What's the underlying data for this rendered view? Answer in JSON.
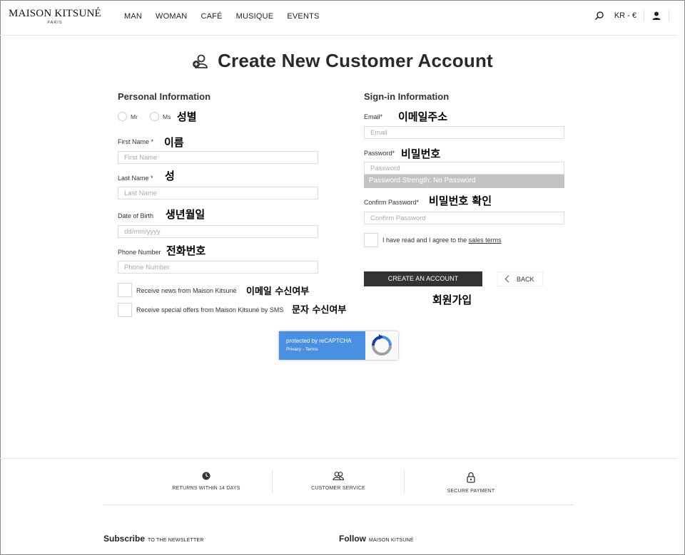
{
  "header": {
    "logo": "MAISON KITSUNÉ",
    "logo_sub": "PARIS",
    "nav": [
      "MAN",
      "WOMAN",
      "CAFÉ",
      "MUSIQUE",
      "EVENTS"
    ],
    "lang": "KR - €"
  },
  "page": {
    "title": "Create New Customer Account"
  },
  "personal": {
    "heading": "Personal Information",
    "mr": "Mr",
    "ms": "Ms",
    "gender_ko": "성별",
    "first_name_label": "First Name *",
    "first_name_ko": "이름",
    "first_name_ph": "First Name",
    "last_name_label": "Last Name *",
    "last_name_ko": "성",
    "last_name_ph": "Last Name",
    "dob_label": "Date of Birth",
    "dob_ko": "생년월일",
    "dob_ph": "dd/mm/yyyy",
    "phone_label": "Phone Number",
    "phone_ko": "전화번호",
    "phone_ph": "Phone Number",
    "news_label": "Receive news from Maison Kitsuné",
    "news_ko": "이메일 수신여부",
    "sms_label": "Receive special offers from Maison Kitsuné by SMS",
    "sms_ko": "문자 수신여부"
  },
  "signin": {
    "heading": "Sign-in Information",
    "email_label": "Email*",
    "email_ko": "이메일주소",
    "email_ph": "Email",
    "password_label": "Password*",
    "password_ko": "비밀번호",
    "password_ph": "Password",
    "strength": "Password Strength: No Password",
    "confirm_label": "Confirm Password*",
    "confirm_ko": "비밀번호 확인",
    "confirm_ph": "Confirm Password",
    "terms_prefix": "I have read and I agree to the ",
    "terms_link": "sales terms",
    "create_button": "CREATE AN ACCOUNT",
    "back_button": "BACK",
    "join_ko": "회원가입"
  },
  "recaptcha": {
    "line1": "protected by reCAPTCHA",
    "line2": "Privacy - Terms"
  },
  "footer": {
    "services": [
      "RETURNS WITHIN 14 DAYS",
      "CUSTOMER SERVICE",
      "SECURE PAYMENT"
    ],
    "subscribe": "Subscribe",
    "subscribe_sub": "TO THE NEWSLETTER",
    "follow": "Follow",
    "follow_sub": "MAISON KITSUNÉ"
  }
}
